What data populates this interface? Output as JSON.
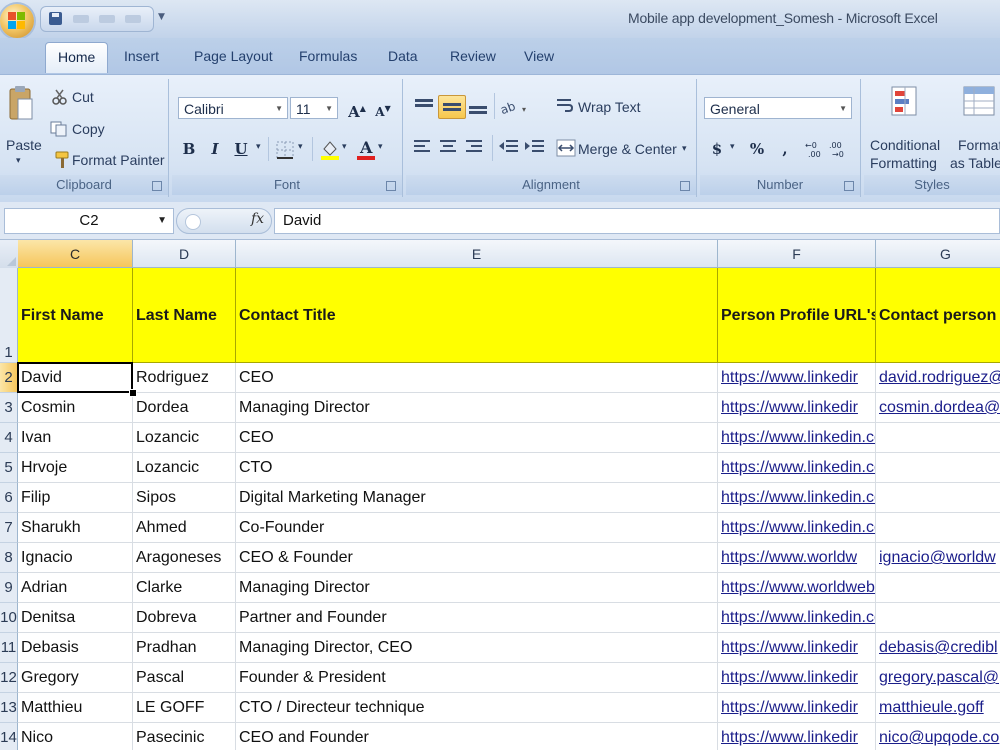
{
  "window": {
    "title": "Mobile app development_Somesh - Microsoft Excel"
  },
  "tabs": [
    "Home",
    "Insert",
    "Page Layout",
    "Formulas",
    "Data",
    "Review",
    "View"
  ],
  "ribbon": {
    "clipboard": {
      "label": "Clipboard",
      "paste": "Paste",
      "cut": "Cut",
      "copy": "Copy",
      "format_painter": "Format Painter"
    },
    "font": {
      "label": "Font",
      "name": "Calibri",
      "size": "11",
      "bold": "B",
      "italic": "I",
      "underline": "U",
      "grow": "A",
      "shrink": "A"
    },
    "alignment": {
      "label": "Alignment",
      "wrap_text": "Wrap Text",
      "merge_center": "Merge & Center"
    },
    "number": {
      "label": "Number",
      "format": "General",
      "currency": "$",
      "percent": "%",
      "comma": ","
    },
    "styles": {
      "label": "Styles",
      "conditional_formatting_1": "Conditional",
      "conditional_formatting_2": "Formatting",
      "format_as_table_1": "Format",
      "format_as_table_2": "as Table"
    }
  },
  "formula_bar": {
    "name_box": "C2",
    "fx": "fx",
    "value": "David"
  },
  "sheet": {
    "columns": [
      "C",
      "D",
      "E",
      "F",
      "G"
    ],
    "selected_column": "C",
    "header_row": {
      "row": "1",
      "cells": [
        "First Name",
        "Last Name",
        "Contact Title",
        "Person Profile URL's",
        "Contact person e"
      ]
    },
    "rows": [
      {
        "row": "2",
        "c": "David",
        "d": "Rodriguez",
        "e": "CEO",
        "f": "https://www.linkedir",
        "g": "david.rodriguez@"
      },
      {
        "row": "3",
        "c": "Cosmin",
        "d": "Dordea",
        "e": "Managing Director",
        "f": "https://www.linkedir",
        "g": "cosmin.dordea@"
      },
      {
        "row": "4",
        "c": "Ivan",
        "d": "Lozancic",
        "e": "CEO",
        "f": "https://www.linkedin.com/in/ilozanci",
        "g": ""
      },
      {
        "row": "5",
        "c": "Hrvoje",
        "d": "Lozancic",
        "e": "CTO",
        "f": "https://www.linkedin.com/in/hlozanc",
        "g": ""
      },
      {
        "row": "6",
        "c": "Filip",
        "d": "Sipos",
        "e": "Digital Marketing Manager",
        "f": "https://www.linkedin.com/in/filip-sip",
        "g": ""
      },
      {
        "row": "7",
        "c": "Sharukh",
        "d": "Ahmed",
        "e": "Co-Founder",
        "f": "https://www.linkedin.com/in/ahmeds",
        "g": ""
      },
      {
        "row": "8",
        "c": "Ignacio",
        "d": "Aragoneses",
        "e": "CEO & Founder",
        "f": "https://www.worldw",
        "g": "ignacio@worldw"
      },
      {
        "row": "9",
        "c": "Adrian",
        "d": "Clarke",
        "e": "Managing Director",
        "f": "https://www.worldwebtechnology.co",
        "g": ""
      },
      {
        "row": "10",
        "c": "Denitsa",
        "d": "Dobreva",
        "e": "Partner and Founder",
        "f": "https://www.linkedin.com/in/denitsa-",
        "g": ""
      },
      {
        "row": "11",
        "c": "Debasis",
        "d": "Pradhan",
        "e": "Managing Director, CEO",
        "f": "https://www.linkedir",
        "g": "debasis@credibl"
      },
      {
        "row": "12",
        "c": "Gregory",
        "d": "Pascal",
        "e": "Founder & President",
        "f": "https://www.linkedir",
        "g": "gregory.pascal@"
      },
      {
        "row": "13",
        "c": "Matthieu",
        "d": "LE GOFF",
        "e": "CTO / Directeur technique",
        "f": "https://www.linkedir",
        "g": "matthieule.goff"
      },
      {
        "row": "14",
        "c": "Nico",
        "d": "Pasecinic",
        "e": "CEO and Founder",
        "f": "https://www.linkedir",
        "g": "nico@upqode.co"
      }
    ]
  },
  "colors": {
    "header_fill": "#ffff00",
    "link": "#1b1e8a",
    "selected_header": "#f6c65c",
    "ribbon": "#d6e3f3"
  }
}
